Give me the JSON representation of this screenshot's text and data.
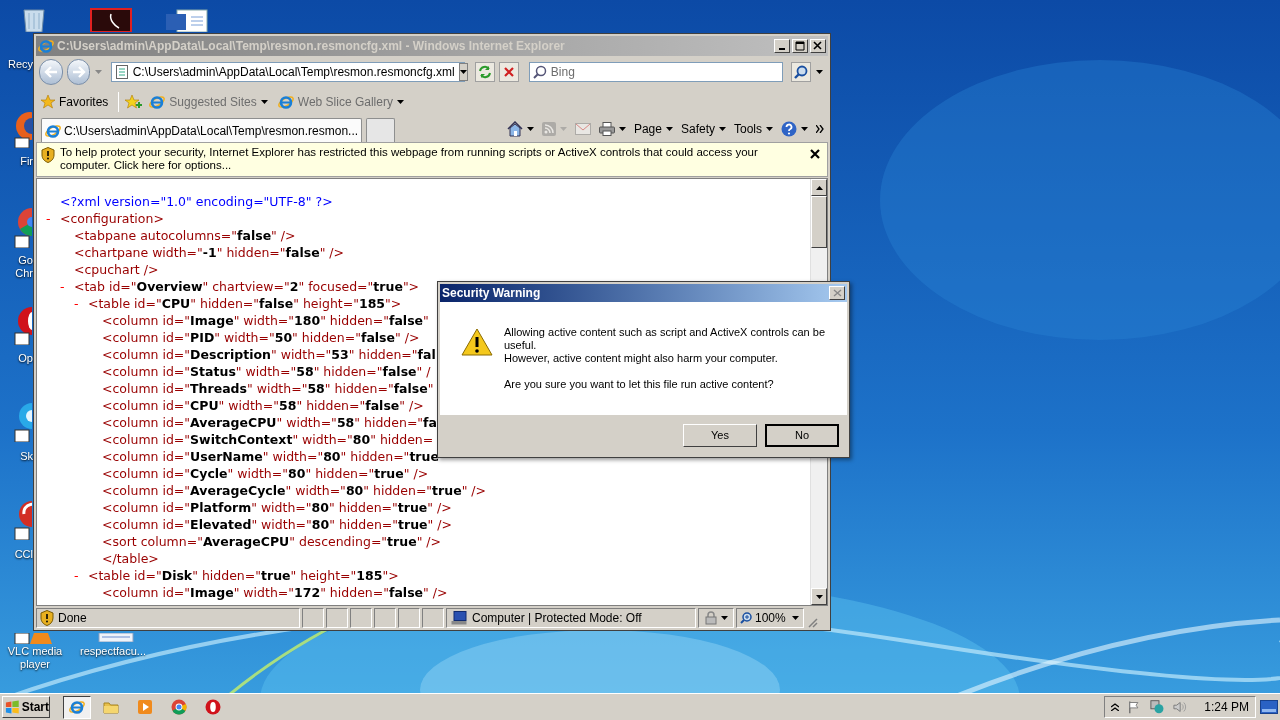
{
  "desktop": {
    "icons": [
      {
        "kind": "recycle-bin",
        "lines": [
          "Recy"
        ]
      },
      {
        "kind": "pdf"
      },
      {
        "kind": "document"
      },
      {
        "kind": "firefox",
        "lines": [
          "Fir"
        ]
      },
      {
        "kind": "chrome",
        "lines": [
          "Go",
          "Chr"
        ]
      },
      {
        "kind": "opera",
        "lines": [
          "Op"
        ]
      },
      {
        "kind": "skype",
        "lines": [
          "Sk"
        ]
      },
      {
        "kind": "ccleaner",
        "lines": [
          "CCl"
        ]
      },
      {
        "kind": "vlc",
        "lines": [
          "VLC media",
          "player"
        ]
      },
      {
        "kind": "file",
        "lines": [
          "respectfacu..."
        ]
      }
    ]
  },
  "browser": {
    "title": "C:\\Users\\admin\\AppData\\Local\\Temp\\resmon.resmoncfg.xml - Windows Internet Explorer",
    "address": "C:\\Users\\admin\\AppData\\Local\\Temp\\resmon.resmoncfg.xml",
    "search_placeholder": "Bing",
    "favorites_bar": [
      {
        "kind": "favorites",
        "label": "Favorites",
        "disabled": false
      },
      {
        "kind": "add"
      },
      {
        "kind": "link",
        "label": "Suggested Sites",
        "disabled": true
      },
      {
        "kind": "link",
        "label": "Web Slice Gallery",
        "disabled": true
      }
    ],
    "tabs": [
      {
        "label": "C:\\Users\\admin\\AppData\\Local\\Temp\\resmon.resmon...",
        "selected": true
      },
      {
        "selected": false
      }
    ],
    "commands": [
      {
        "kind": "home",
        "disabled": false
      },
      {
        "kind": "feeds",
        "disabled": true
      },
      {
        "kind": "mail",
        "disabled": true
      },
      {
        "kind": "print",
        "disabled": false
      },
      {
        "kind": "menu",
        "label": "Page",
        "disabled": false
      },
      {
        "kind": "menu",
        "label": "Safety",
        "disabled": false
      },
      {
        "kind": "menu",
        "label": "Tools",
        "disabled": false
      },
      {
        "kind": "help",
        "disabled": false
      }
    ],
    "info_bar": "To help protect your security, Internet Explorer has restricted this webpage from running scripts or ActiveX controls that could access your computer. Click here for options...",
    "content": {
      "nodes": [
        {
          "kind": "declaration",
          "text": "<?xml version=\"1.0\" encoding=\"UTF-8\" ?>"
        },
        {
          "kind": "element",
          "toggle": "-",
          "text": "<configuration>",
          "children": [
            {
              "kind": "element",
              "text": "<tabpane autocolumns=\"**false**\" />"
            },
            {
              "kind": "element",
              "text": "<chartpane width=\"**-1**\" hidden=\"**false**\" />"
            },
            {
              "kind": "element",
              "text": "<cpuchart />"
            },
            {
              "kind": "element",
              "toggle": "-",
              "text": "<tab id=\"**Overview**\" chartview=\"**2**\" focused=\"**true**\">",
              "children": [
                {
                  "kind": "element",
                  "toggle": "-",
                  "text": "<table id=\"**CPU**\" hidden=\"**false**\" height=\"**185**\">",
                  "close": "</table>",
                  "children": [
                    {
                      "kind": "element",
                      "text": "<column id=\"**Image**\" width=\"**180**\" hidden=\"**false**\""
                    },
                    {
                      "kind": "element",
                      "text": "<column id=\"**PID**\" width=\"**50**\" hidden=\"**false**\" />"
                    },
                    {
                      "kind": "element",
                      "text": "<column id=\"**Description**\" width=\"**53**\" hidden=\"**fal**"
                    },
                    {
                      "kind": "element",
                      "text": "<column id=\"**Status**\" width=\"**58**\" hidden=\"**false**\" /"
                    },
                    {
                      "kind": "element",
                      "text": "<column id=\"**Threads**\" width=\"**58**\" hidden=\"**false**\""
                    },
                    {
                      "kind": "element",
                      "text": "<column id=\"**CPU**\" width=\"**58**\" hidden=\"**false**\" />"
                    },
                    {
                      "kind": "element",
                      "text": "<column id=\"**AverageCPU**\" width=\"**58**\" hidden=\"**fa**"
                    },
                    {
                      "kind": "element",
                      "text": "<column id=\"**SwitchContext**\" width=\"**80**\" hidden="
                    },
                    {
                      "kind": "element",
                      "text": "<column id=\"**UserName**\" width=\"**80**\" hidden=\"**true**"
                    },
                    {
                      "kind": "element",
                      "text": "<column id=\"**Cycle**\" width=\"**80**\" hidden=\"**true**\" />"
                    },
                    {
                      "kind": "element",
                      "text": "<column id=\"**AverageCycle**\" width=\"**80**\" hidden=\"**true**\" />"
                    },
                    {
                      "kind": "element",
                      "text": "<column id=\"**Platform**\" width=\"**80**\" hidden=\"**true**\" />"
                    },
                    {
                      "kind": "element",
                      "text": "<column id=\"**Elevated**\" width=\"**80**\" hidden=\"**true**\" />"
                    },
                    {
                      "kind": "element",
                      "text": "<sort column=\"**AverageCPU**\" descending=\"**true**\" />"
                    }
                  ]
                },
                {
                  "kind": "element",
                  "toggle": "-",
                  "text": "<table id=\"**Disk**\" hidden=\"**true**\" height=\"**185**\">",
                  "children": [
                    {
                      "kind": "element",
                      "text": "<column id=\"**Image**\" width=\"**172**\" hidden=\"**false**\" />"
                    }
                  ]
                }
              ]
            }
          ]
        }
      ]
    },
    "status_bar": {
      "status": "Done",
      "zone": "Computer | Protected Mode: Off",
      "zoom": "100%"
    }
  },
  "dialog": {
    "title": "Security Warning",
    "lines": [
      "Allowing active content such as script and ActiveX controls can be useful.",
      "However, active content might also harm your computer."
    ],
    "question": "Are you sure you want to let this file run active content?",
    "buttons": [
      {
        "label": "Yes",
        "default": false
      },
      {
        "label": "No",
        "default": true
      }
    ]
  },
  "taskbar": {
    "start": "Start",
    "items": [
      {
        "kind": "ie",
        "selected": true
      },
      {
        "kind": "folder",
        "selected": false
      },
      {
        "kind": "media",
        "selected": false
      },
      {
        "kind": "chrome",
        "selected": false
      },
      {
        "kind": "opera",
        "selected": false
      }
    ],
    "clock": "1:24 PM"
  }
}
